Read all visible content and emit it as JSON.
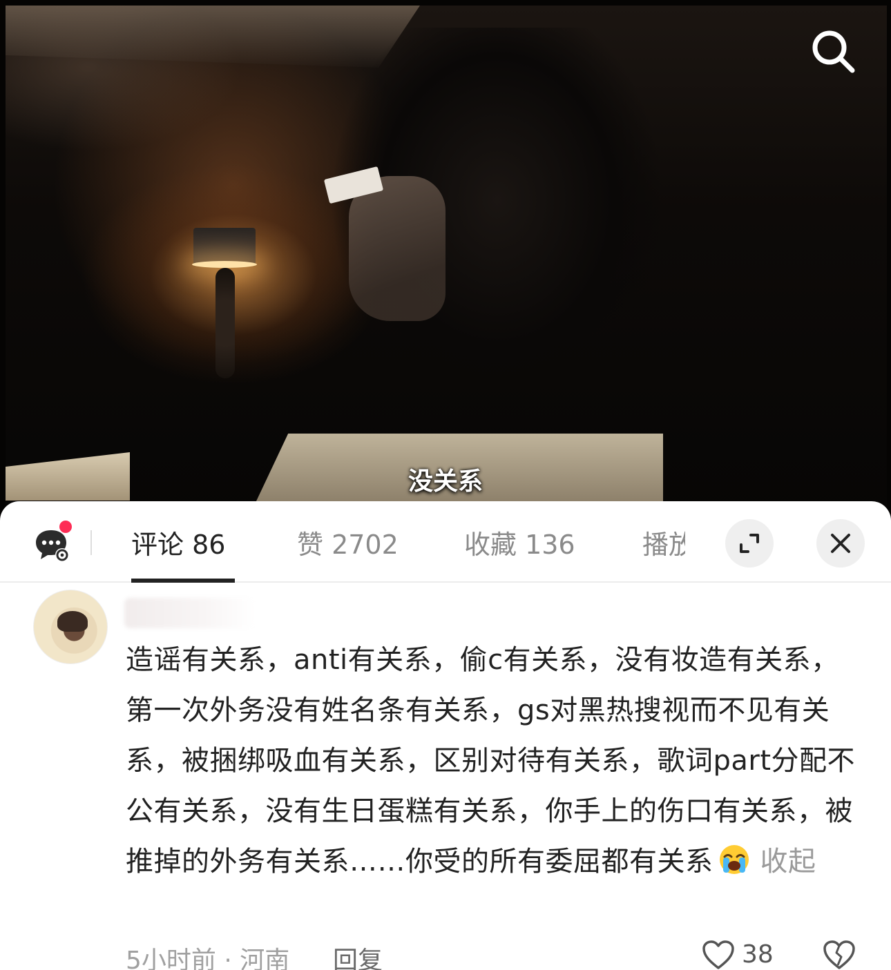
{
  "video": {
    "subtitle": "没关系",
    "search_icon": "search-icon"
  },
  "tabs": {
    "comments": "评论 86",
    "likes": "赞 2702",
    "favorites": "收藏 136",
    "plays": "播放"
  },
  "comment": {
    "text": "造谣有关系，anti有关系，偷c有关系，没有妆造有关系，第一次外务没有姓名条有关系，gs对黑热搜视而不见有关系，被捆绑吸血有关系，区别对待有关系，歌词part分配不公有关系，没有生日蛋糕有关系，你手上的伤口有关系，被推掉的外务有关系……你受的所有委屈都有关系",
    "emoji": "crying-face",
    "collapse_label": "收起",
    "meta": "5小时前 · 河南",
    "reply_label": "回复",
    "like_count": "38"
  },
  "colors": {
    "accent_dot": "#fe2c55",
    "text_primary": "#222222",
    "text_secondary": "#8a8a8a"
  }
}
